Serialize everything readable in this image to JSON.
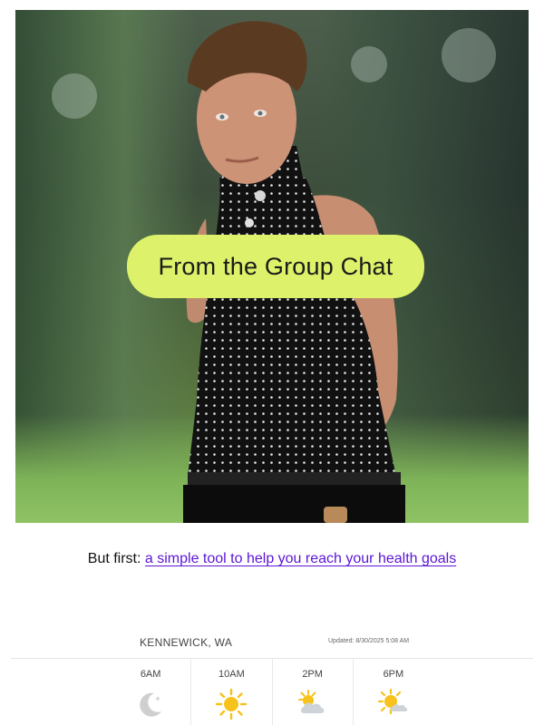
{
  "hero": {
    "bubble_text": "From the Group Chat"
  },
  "intro": {
    "prefix": "But first:",
    "link_text": "a simple tool to help you reach your health goals"
  },
  "weather": {
    "location": "KENNEWICK, WA",
    "updated": "Updated: 8/30/2025 5:08 AM",
    "forecast": [
      {
        "time": "6AM",
        "icon": "moon-icon"
      },
      {
        "time": "10AM",
        "icon": "sun-icon"
      },
      {
        "time": "2PM",
        "icon": "partly-cloudy-icon"
      },
      {
        "time": "6PM",
        "icon": "sun-behind-cloud-icon"
      }
    ]
  },
  "colors": {
    "bubble": "#ddf26a",
    "link": "#5b15d6",
    "sun": "#f6c21b"
  }
}
